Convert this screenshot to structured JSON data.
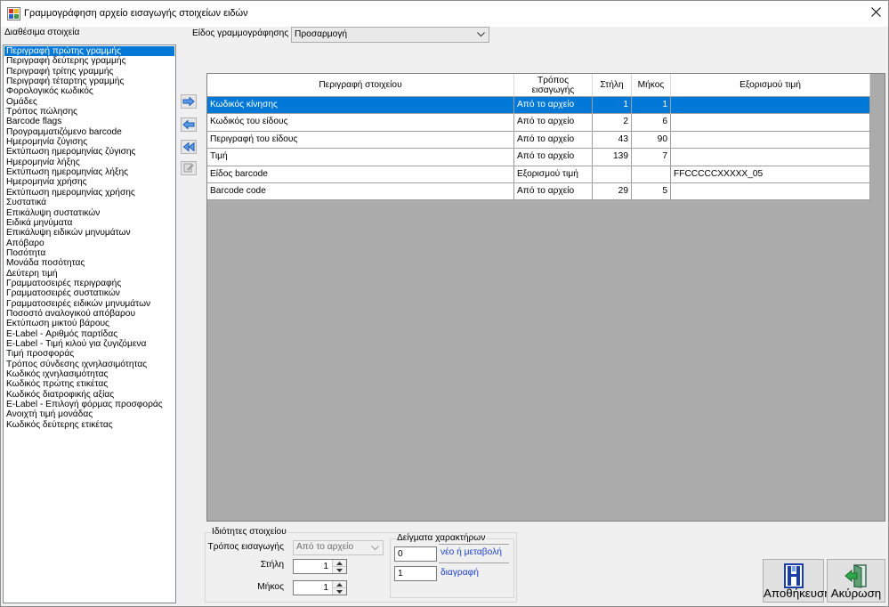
{
  "window": {
    "title": "Γραμμογράφηση αρχείο εισαγωγής στοιχείων ειδών",
    "icon": "app-icon",
    "close_icon": "close-icon"
  },
  "available": {
    "label": "Διαθέσιμα στοιχεία",
    "selected_index": 0,
    "items": [
      "Περιγραφή πρώτης γραμμής",
      "Περιγραφή δεύτερης γραμμής",
      "Περιγραφή τρίτης γραμμής",
      "Περιγραφή τέταρτης γραμμής",
      "Φορολογικός κωδικός",
      "Ομάδες",
      "Τρόπος πώλησης",
      "Barcode flags",
      "Προγραμματιζόμενο barcode",
      "Ημερομηνία ζύγισης",
      "Εκτύπωση ημερομηνίας ζύγισης",
      "Ημερομηνία λήξης",
      "Εκτύπωση ημερομηνίας λήξης",
      "Ημερομηνία χρήσης",
      "Εκτύπωση ημερομηνίας χρήσης",
      "Συστατικά",
      "Επικάλυψη συστατικών",
      "Ειδικά μηνύματα",
      "Επικάλυψη ειδικών μηνυμάτων",
      "Απόβαρο",
      "Ποσότητα",
      "Μονάδα ποσότητας",
      "Δεύτερη τιμή",
      "Γραμματοσειρές περιγραφής",
      "Γραμματοσειρές συστατικών",
      "Γραμματοσειρές ειδικών μηνυμάτων",
      "Ποσοστό αναλογικού απόβαρου",
      "Εκτύπωση μικτού βάρους",
      "E-Label - Αριθμός παρτίδας",
      "E-Label - Τιμή κιλού για ζυγιζόμενα",
      "Τιμή προσφοράς",
      "Τρόπος σύνδεσης ιχνηλασιμότητας",
      "Κωδικός ιχνηλασιμότητας",
      "Κωδικός πρώτης ετικέτας",
      "Κωδικός διατροφικής αξίας",
      "E-Label - Επιλογή φόρμας προσφοράς",
      "Ανοιχτή τιμή μονάδας",
      "Κωδικός δεύτερης ετικέτας"
    ]
  },
  "transfer_buttons": [
    {
      "icon": "arrow-right-icon",
      "enabled": true
    },
    {
      "icon": "arrow-left-icon",
      "enabled": true
    },
    {
      "icon": "double-arrow-left-icon",
      "enabled": true
    },
    {
      "icon": "edit-icon",
      "enabled": false
    }
  ],
  "layout_type": {
    "label": "Είδος γραμμογράφησης",
    "value": "Προσαρμογή"
  },
  "grid": {
    "columns": [
      "Περιγραφή στοιχείου",
      "Τρόπος εισαγωγής",
      "Στήλη",
      "Μήκος",
      "Εξορισμού τιμή"
    ],
    "selected_row": 0,
    "rows": [
      {
        "description": "Κωδικός κίνησης",
        "mode": "Από το αρχείο",
        "column": 1,
        "length": 1,
        "default_value": ""
      },
      {
        "description": "Κωδικός του είδους",
        "mode": "Από το αρχείο",
        "column": 2,
        "length": 6,
        "default_value": ""
      },
      {
        "description": "Περιγραφή του είδους",
        "mode": "Από το αρχείο",
        "column": 43,
        "length": 90,
        "default_value": ""
      },
      {
        "description": "Τιμή",
        "mode": "Από το αρχείο",
        "column": 139,
        "length": 7,
        "default_value": ""
      },
      {
        "description": "Είδος barcode",
        "mode": "Εξορισμού τιμή",
        "column": "",
        "length": "",
        "default_value": "FFCCCCCXXXXX_05"
      },
      {
        "description": "Barcode code",
        "mode": "Από το αρχείο",
        "column": 29,
        "length": 5,
        "default_value": ""
      }
    ]
  },
  "properties": {
    "legend": "Ιδιότητες στοιχείου",
    "mode_label": "Τρόπος εισαγωγής",
    "mode_value": "Από το αρχείο",
    "column_label": "Στήλη",
    "column_value": "1",
    "length_label": "Μήκος",
    "length_value": "1"
  },
  "samples": {
    "legend": "Δείγματα χαρακτήρων",
    "new_value": "0",
    "new_label": "νέο ή μεταβολή",
    "delete_value": "1",
    "delete_label": "διαγραφή"
  },
  "actions": {
    "save_label": "Αποθήκευση",
    "save_icon": "save-icon",
    "cancel_label": "Ακύρωση",
    "cancel_icon": "exit-door-icon"
  },
  "colors": {
    "selection": "#0078d7",
    "grid_background": "#ababab",
    "sample_label": "#1a3ccf"
  }
}
